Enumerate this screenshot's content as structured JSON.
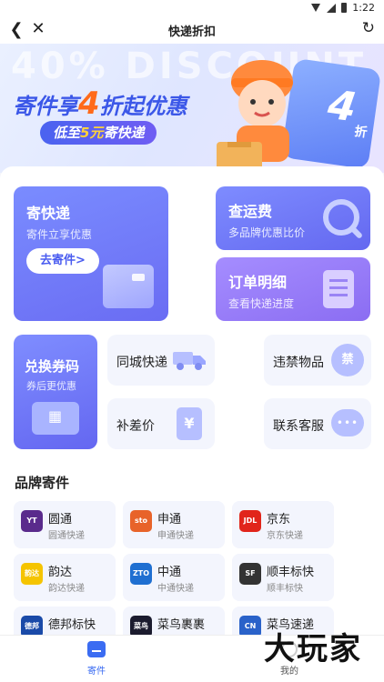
{
  "status_bar": {
    "time": "1:22"
  },
  "titlebar": {
    "title": "快递折扣"
  },
  "banner": {
    "watermark": "40% DISCOUNT",
    "headline_pre": "寄件享",
    "headline_num": "4",
    "headline_post": "折起优惠",
    "pill_pre": "低至",
    "pill_hl": "5元",
    "pill_post": "寄快递",
    "ticket_num": "4",
    "ticket_unit": "折"
  },
  "cards": {
    "send": {
      "title": "寄快递",
      "subtitle": "寄件立享优惠",
      "button": "去寄件>"
    },
    "fee": {
      "title": "查运费",
      "subtitle": "多品牌优惠比价"
    },
    "order": {
      "title": "订单明细",
      "subtitle": "查看快递进度"
    },
    "coupon": {
      "title": "兑换券码",
      "subtitle": "券后更优惠"
    },
    "city": {
      "title": "同城快递"
    },
    "banned": {
      "title": "违禁物品",
      "icon_text": "禁"
    },
    "diff": {
      "title": "补差价",
      "icon_text": "¥"
    },
    "cs": {
      "title": "联系客服",
      "icon_text": "•••"
    }
  },
  "brands_title": "品牌寄件",
  "brands": [
    {
      "name": "圆通",
      "sub": "圆通快递",
      "logo": "YT",
      "color": "#5a2b8c"
    },
    {
      "name": "申通",
      "sub": "申通快递",
      "logo": "sto",
      "color": "#e8632a"
    },
    {
      "name": "京东",
      "sub": "京东快递",
      "logo": "JDL",
      "color": "#e1251b"
    },
    {
      "name": "韵达",
      "sub": "韵达快递",
      "logo": "韵达",
      "color": "#f5c400"
    },
    {
      "name": "中通",
      "sub": "中通快递",
      "logo": "ZTO",
      "color": "#1f6fd1"
    },
    {
      "name": "顺丰标快",
      "sub": "顺丰标快",
      "logo": "SF",
      "color": "#333333"
    },
    {
      "name": "德邦标快",
      "sub": "",
      "logo": "德邦",
      "color": "#1a4aa8"
    },
    {
      "name": "菜鸟裹裹",
      "sub": "",
      "logo": "菜鸟",
      "color": "#1b1b2e"
    },
    {
      "name": "菜鸟速递",
      "sub": "",
      "logo": "CN",
      "color": "#2a62c9"
    }
  ],
  "tabbar": {
    "send": "寄件",
    "mine": "我的"
  },
  "watermark_text": "大玩家",
  "colors": {
    "accent": "#3b6cf2",
    "card_primary": "#6a6cf3",
    "card_purple": "#8b6df2",
    "orange": "#ff6a1a"
  }
}
